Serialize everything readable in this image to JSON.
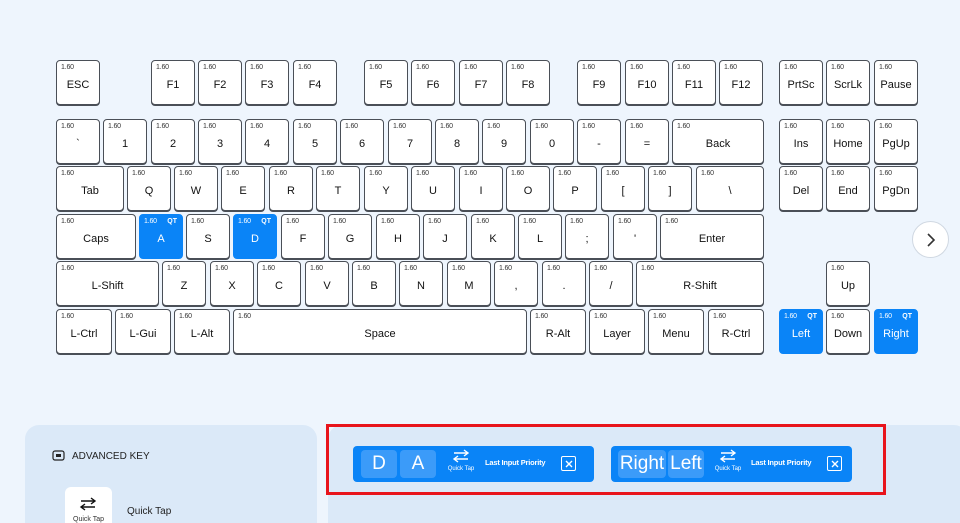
{
  "keyboard": {
    "value_label": "1.60",
    "qt_label": "QT",
    "rows": [
      [
        [
          "ESC",
          56
        ],
        [
          "F1",
          151
        ],
        [
          "F2",
          198
        ],
        [
          "F3",
          245
        ],
        [
          "F4",
          293
        ],
        [
          "F5",
          364
        ],
        [
          "F6",
          411
        ],
        [
          "F7",
          459
        ],
        [
          "F8",
          506
        ],
        [
          "F9",
          577
        ],
        [
          "F10",
          625
        ],
        [
          "F11",
          672
        ],
        [
          "F12",
          719
        ],
        [
          "PrtSc",
          779
        ],
        [
          "ScrLk",
          826
        ],
        [
          "Pause",
          874
        ]
      ],
      [
        [
          "`",
          56
        ],
        [
          "1",
          103
        ],
        [
          "2",
          151
        ],
        [
          "3",
          198
        ],
        [
          "4",
          245
        ],
        [
          "5",
          293
        ],
        [
          "6",
          340
        ],
        [
          "7",
          388
        ],
        [
          "8",
          435
        ],
        [
          "9",
          482
        ],
        [
          "0",
          530
        ],
        [
          "-",
          577
        ],
        [
          "=",
          625
        ],
        [
          "Back",
          672
        ],
        [
          "Ins",
          779
        ],
        [
          "Home",
          826
        ],
        [
          "PgUp",
          874
        ]
      ],
      [
        [
          "Tab",
          56
        ],
        [
          "Q",
          127
        ],
        [
          "W",
          174
        ],
        [
          "E",
          221
        ],
        [
          "R",
          269
        ],
        [
          "T",
          316
        ],
        [
          "Y",
          364
        ],
        [
          "U",
          411
        ],
        [
          "I",
          459
        ],
        [
          "O",
          506
        ],
        [
          "P",
          553
        ],
        [
          "[",
          601
        ],
        [
          "]",
          648
        ],
        [
          "\\",
          696
        ],
        [
          "Del",
          779
        ],
        [
          "End",
          826
        ],
        [
          "PgDn",
          874
        ]
      ],
      [
        [
          "Caps",
          56
        ],
        [
          "A",
          139
        ],
        [
          "S",
          186
        ],
        [
          "D",
          233
        ],
        [
          "F",
          281
        ],
        [
          "G",
          328
        ],
        [
          "H",
          376
        ],
        [
          "J",
          423
        ],
        [
          "K",
          471
        ],
        [
          "L",
          518
        ],
        [
          ";",
          565
        ],
        [
          "'",
          613
        ],
        [
          "Enter",
          660
        ]
      ],
      [
        [
          "L-Shift",
          56
        ],
        [
          "Z",
          162
        ],
        [
          "X",
          210
        ],
        [
          "C",
          257
        ],
        [
          "V",
          305
        ],
        [
          "B",
          352
        ],
        [
          "N",
          399
        ],
        [
          "M",
          447
        ],
        [
          ",",
          494
        ],
        [
          ".",
          542
        ],
        [
          "/",
          589
        ],
        [
          "R-Shift",
          636
        ],
        [
          "Up",
          826
        ]
      ],
      [
        [
          "L-Ctrl",
          56
        ],
        [
          "L-Gui",
          115
        ],
        [
          "L-Alt",
          174
        ],
        [
          "Space",
          233
        ],
        [
          "R-Alt",
          530
        ],
        [
          "Layer",
          589
        ],
        [
          "Menu",
          648
        ],
        [
          "R-Ctrl",
          708
        ],
        [
          "Left",
          779
        ],
        [
          "Down",
          826
        ],
        [
          "Right",
          874
        ]
      ]
    ]
  },
  "advanced_key": {
    "title": "ADVANCED KEY",
    "quick_tap_caption": "Quick Tap",
    "quick_tap_label": "Quick Tap"
  },
  "bindings": [
    {
      "key1": "D",
      "key2": "A",
      "mode_caption": "Quick Tap",
      "priority": "Last Input Priority"
    },
    {
      "key1": "Right",
      "key2": "Left",
      "mode_caption": "Quick Tap",
      "priority": "Last Input Priority"
    }
  ],
  "colors": {
    "accent": "#0a84f7",
    "highlight": "#e8141c",
    "panel": "#dbe9f8"
  },
  "icons": [
    "chevron-right-icon",
    "advanced-key-icon",
    "swap-arrows-icon",
    "close-icon"
  ]
}
